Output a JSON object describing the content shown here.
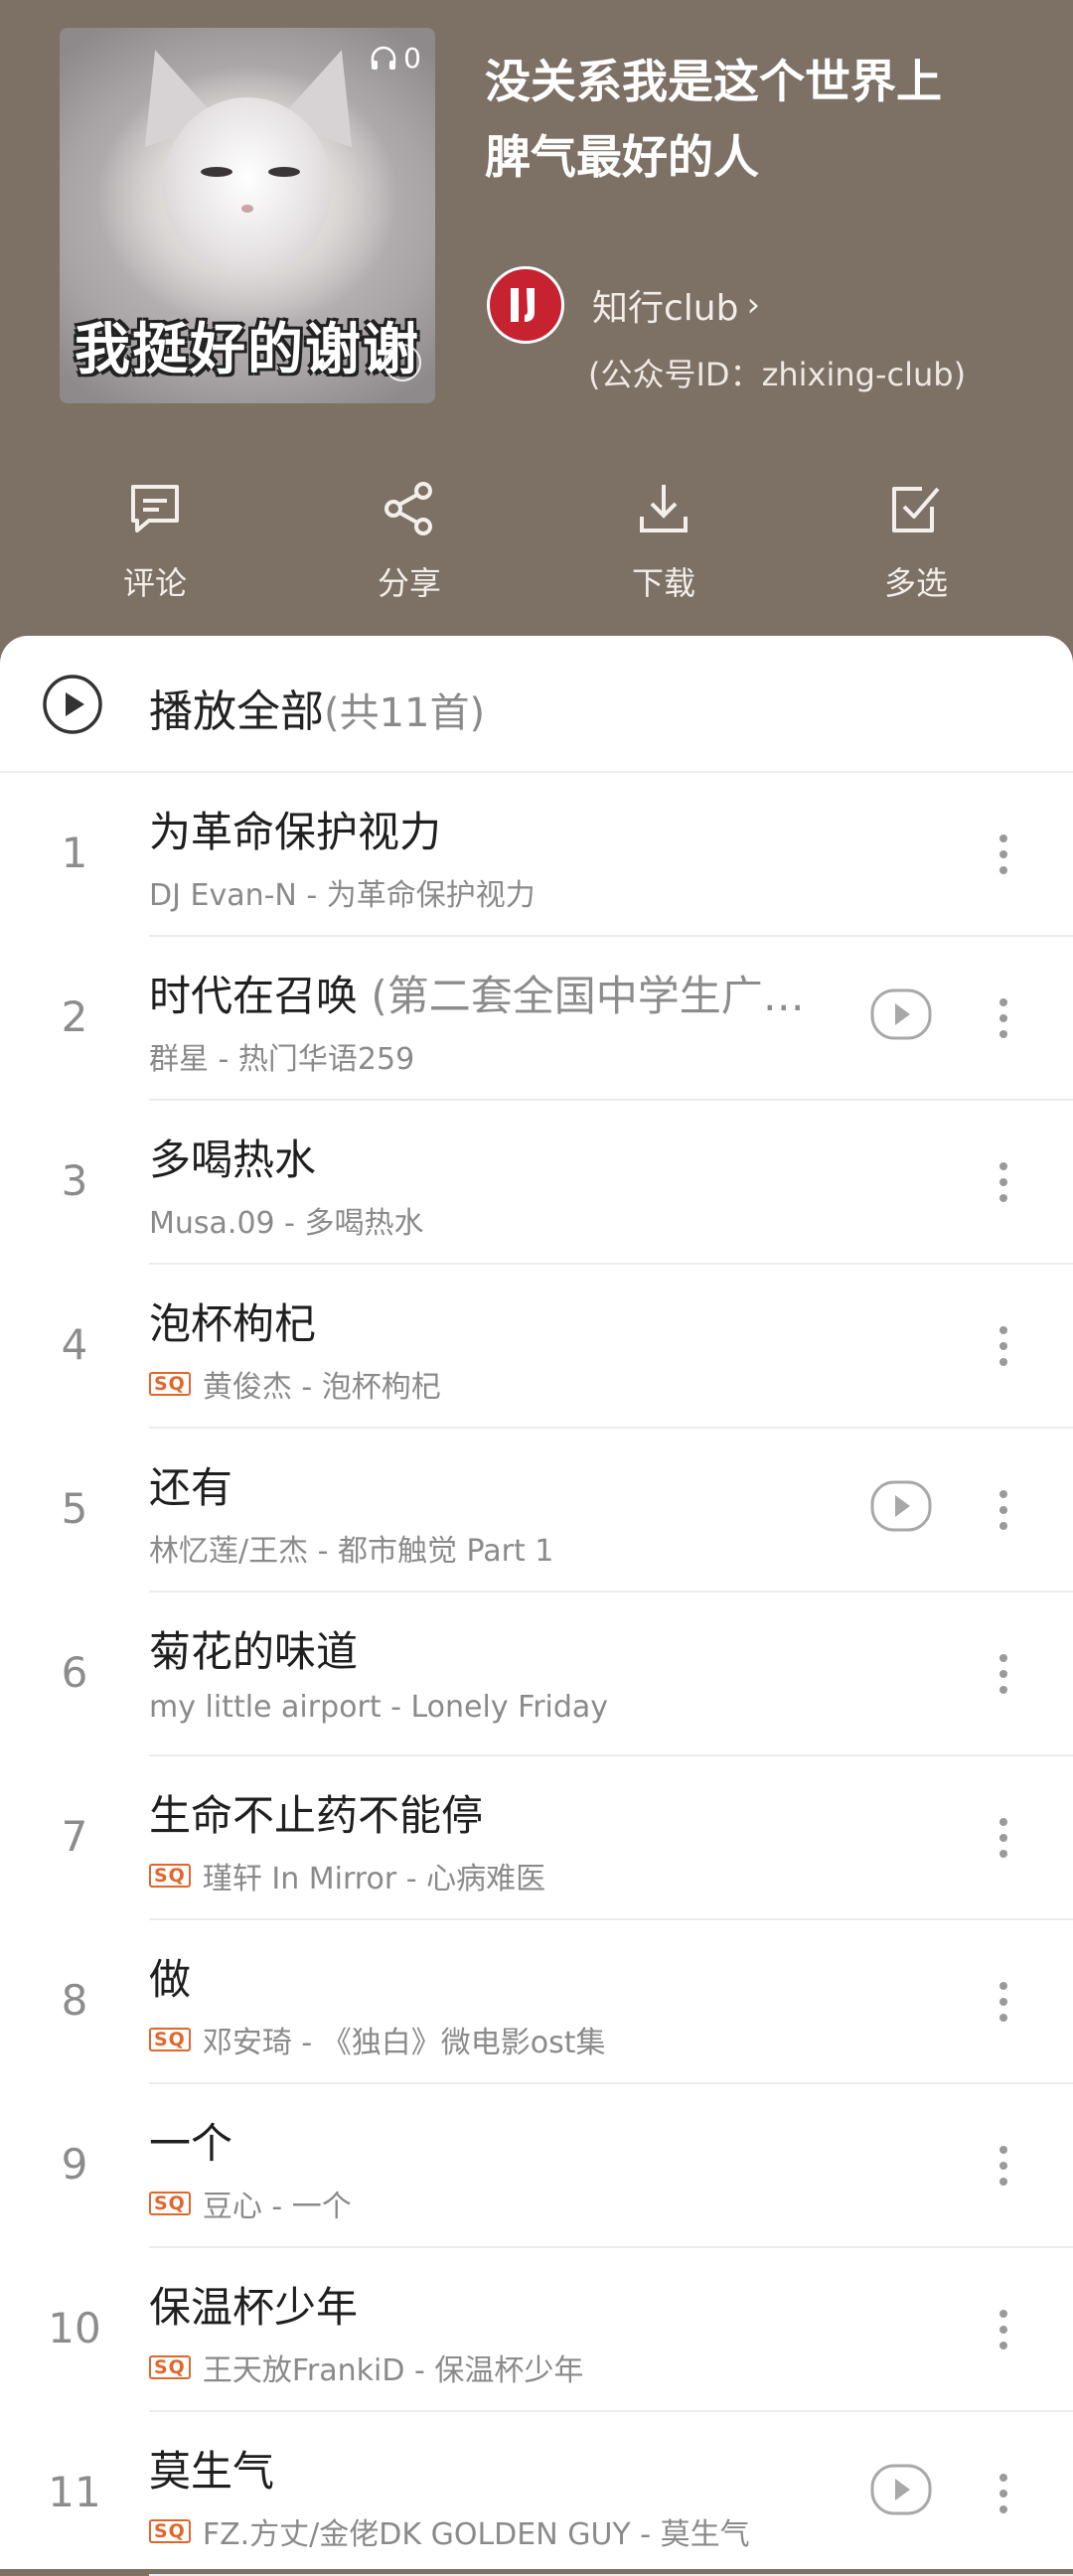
{
  "playlist": {
    "title_line1": "没关系我是这个世界上",
    "title_line2": "脾气最好的人",
    "play_count": "0",
    "cover_caption": "我挺好的谢谢",
    "creator_name": "知行club",
    "creator_note": "(公众号ID：zhixing-club)"
  },
  "actions": {
    "comment": "评论",
    "share": "分享",
    "download": "下载",
    "multiselect": "多选"
  },
  "play_all": {
    "label": "播放全部",
    "count": "(共11首)"
  },
  "songs": [
    {
      "index": "1",
      "title": "为革命保护视力",
      "subtitle": "",
      "sq": false,
      "mv": false,
      "info": "DJ Evan-N - 为革命保护视力"
    },
    {
      "index": "2",
      "title": "时代在召唤",
      "subtitle": " (第二套全国中学生广…",
      "sq": false,
      "mv": true,
      "info": "群星 - 热门华语259"
    },
    {
      "index": "3",
      "title": "多喝热水",
      "subtitle": "",
      "sq": false,
      "mv": false,
      "info": "Musa.09 - 多喝热水"
    },
    {
      "index": "4",
      "title": "泡杯枸杞",
      "subtitle": "",
      "sq": true,
      "mv": false,
      "info": "黄俊杰 - 泡杯枸杞"
    },
    {
      "index": "5",
      "title": "还有",
      "subtitle": "",
      "sq": false,
      "mv": true,
      "info": "林忆莲/王杰 - 都市触觉 Part 1"
    },
    {
      "index": "6",
      "title": "菊花的味道",
      "subtitle": "",
      "sq": false,
      "mv": false,
      "info": "my little airport - Lonely Friday"
    },
    {
      "index": "7",
      "title": "生命不止药不能停",
      "subtitle": "",
      "sq": true,
      "mv": false,
      "info": "瑾轩 In Mirror - 心病难医"
    },
    {
      "index": "8",
      "title": "做",
      "subtitle": "",
      "sq": true,
      "mv": false,
      "info": "邓安琦 - 《独白》微电影ost集"
    },
    {
      "index": "9",
      "title": "一个",
      "subtitle": "",
      "sq": true,
      "mv": false,
      "info": "豆心 - 一个"
    },
    {
      "index": "10",
      "title": "保温杯少年",
      "subtitle": "",
      "sq": true,
      "mv": false,
      "info": "王天放FrankiD - 保温杯少年"
    },
    {
      "index": "11",
      "title": "莫生气",
      "subtitle": "",
      "sq": true,
      "mv": true,
      "info": "FZ.方丈/金佬DK GOLDEN GUY - 莫生气"
    }
  ],
  "badge_text": "SQ",
  "icons": {
    "comment": "comment-icon",
    "share": "share-icon",
    "download": "download-icon",
    "multiselect": "checkbox-icon",
    "play_all": "play-circle-icon",
    "mv": "mv-play-icon",
    "more": "more-vertical-icon",
    "headphones": "headphones-icon"
  },
  "colors": {
    "header_bg": "#7d7065",
    "sq_badge": "#e2662a",
    "avatar_bg": "#c62230"
  }
}
